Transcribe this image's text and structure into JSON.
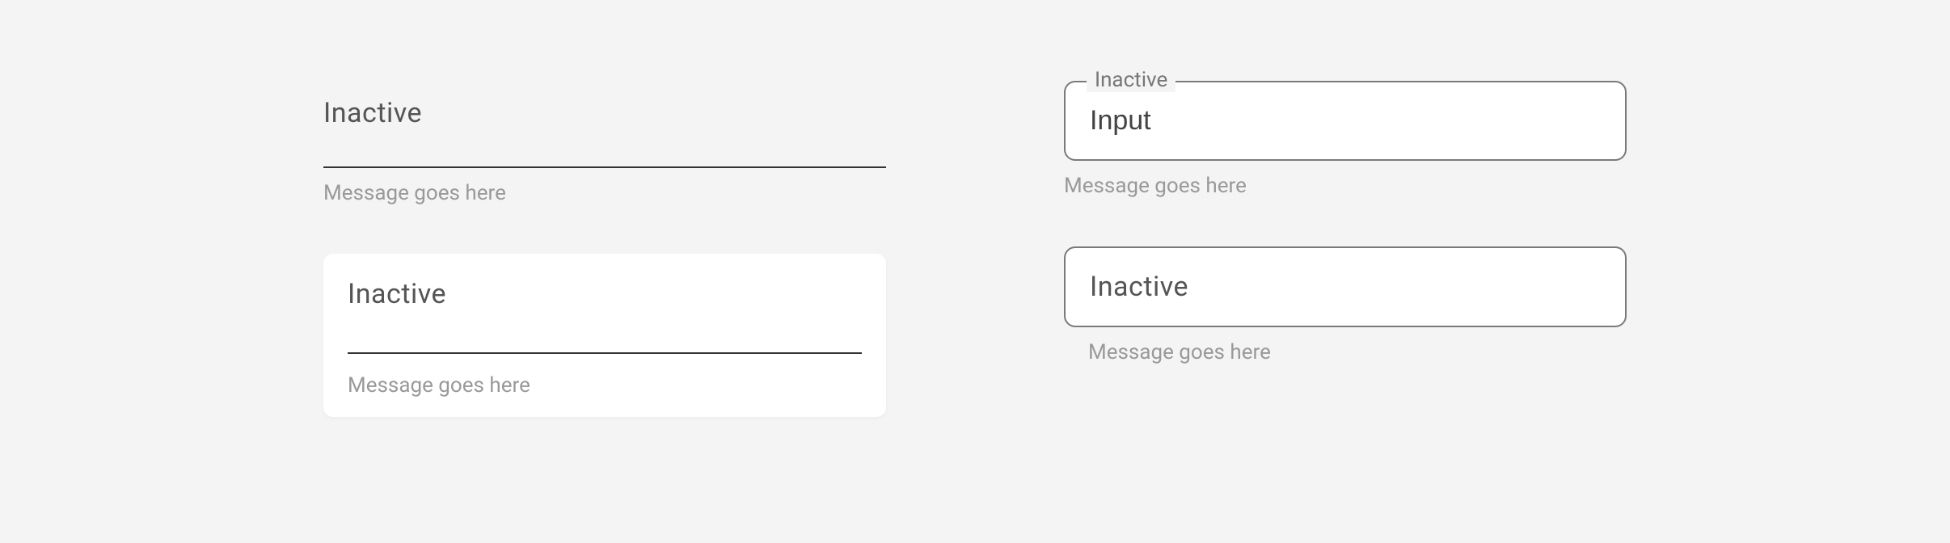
{
  "fields": {
    "underline": {
      "label": "Inactive",
      "helper": "Message goes here"
    },
    "card": {
      "label": "Inactive",
      "helper": "Message goes here"
    },
    "outlinedFloat": {
      "floatLabel": "Inactive",
      "value": "Input",
      "helper": "Message goes here"
    },
    "outlined": {
      "label": "Inactive",
      "helper": "Message goes here"
    }
  }
}
